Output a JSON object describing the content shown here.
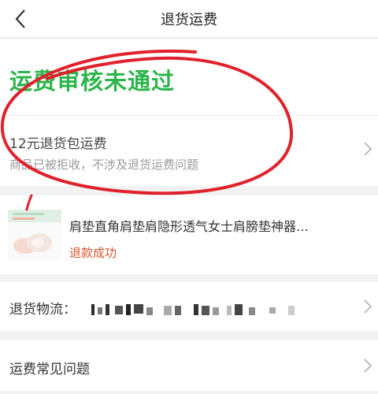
{
  "nav": {
    "title": "退货运费"
  },
  "status": {
    "title": "运费审核未通过",
    "fee_title": "12元退货包运费",
    "fee_subtitle": "商品已被拒收，不涉及退货运费问题"
  },
  "product": {
    "name": "肩垫直角肩垫肩隐形透气女士肩膀垫神器…",
    "refund_status": "退款成功"
  },
  "logistics": {
    "label": "退货物流："
  },
  "faq": {
    "label": "运费常见问题"
  },
  "colors": {
    "success_green": "#2bb54b",
    "refund_red": "#d9532c",
    "annotation_red": "#e0212b"
  }
}
